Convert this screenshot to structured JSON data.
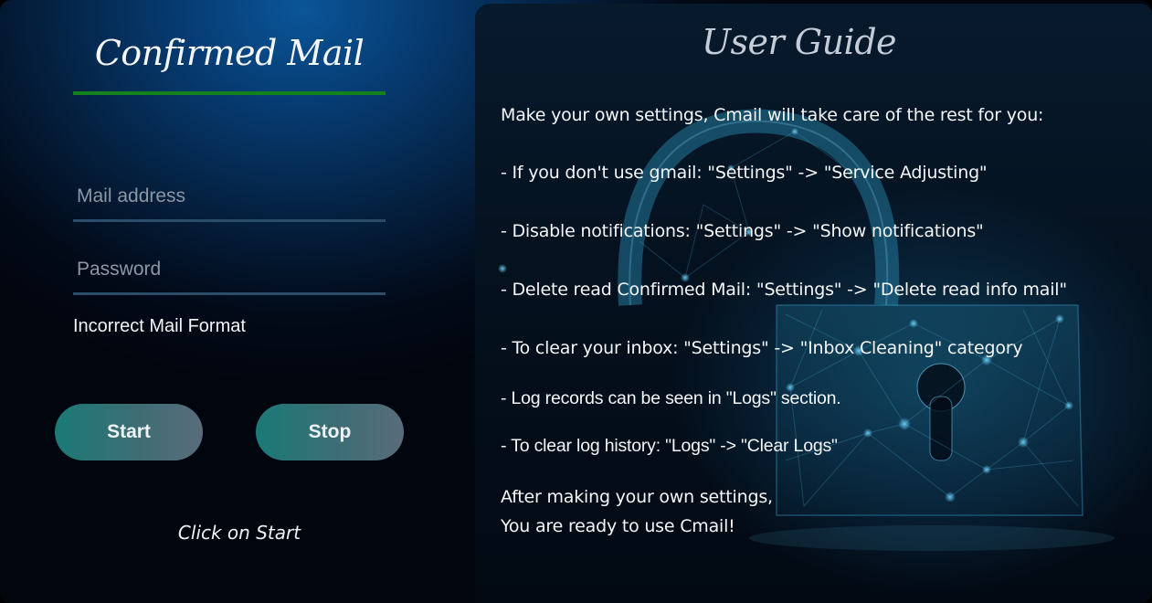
{
  "login": {
    "title": "Confirmed Mail",
    "mail_placeholder": "Mail address",
    "password_placeholder": "Password",
    "error_message": "Incorrect Mail Format",
    "start_label": "Start",
    "stop_label": "Stop",
    "hint": "Click on Start"
  },
  "guide": {
    "title": "User Guide",
    "lines": [
      "Make your own settings, Cmail will take care of the rest for you:",
      "- If you don't use gmail: \"Settings\" -> \"Service Adjusting\"",
      "- Disable notifications: \"Settings\" -> \"Show notifications\"",
      "- Delete read Confirmed Mail: \"Settings\" -> \"Delete read info mail\"",
      "- To clear your inbox: \"Settings\" -> \"Inbox Cleaning\" category",
      "- Log records can be seen in \"Logs\" section.",
      "- To clear log history: \"Logs\" -> \"Clear Logs\"",
      "After making your own settings,",
      "You are ready to use Cmail!"
    ]
  },
  "colors": {
    "accent_underline": "#13821c",
    "button_gradient_start": "#1a7a76",
    "button_gradient_end": "#596c7c"
  },
  "icons": {
    "background_art": "padlock-network-icon"
  }
}
